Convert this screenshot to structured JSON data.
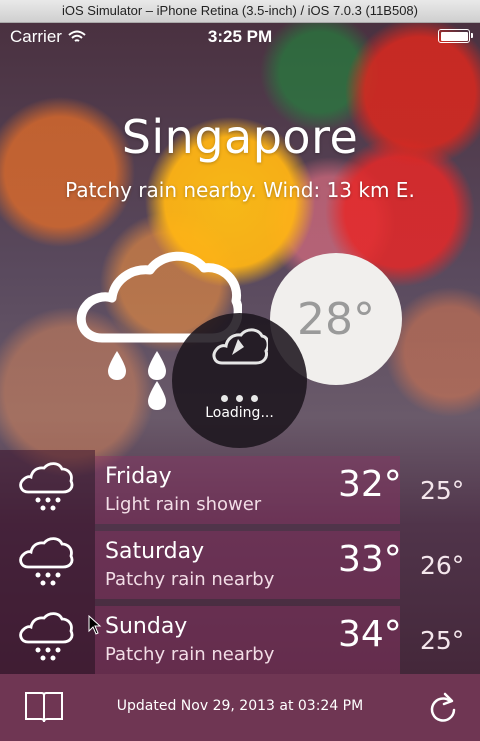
{
  "window": {
    "title": "iOS Simulator – iPhone Retina (3.5-inch) / iOS 7.0.3 (11B508)"
  },
  "status_bar": {
    "carrier": "Carrier",
    "time": "3:25 PM",
    "wifi_icon": "wifi-icon",
    "battery_icon": "battery-icon"
  },
  "current": {
    "city": "Singapore",
    "conditions": "Patchy rain nearby. Wind: 13 km E.",
    "temperature": "28°",
    "icon": "cloud-rain-icon"
  },
  "loading": {
    "label": "Loading...",
    "icon": "cloud-lightning-icon"
  },
  "forecast": [
    {
      "day": "Friday",
      "description": "Light rain shower",
      "high": "32°",
      "low": "25°",
      "icon": "cloud-rain-icon"
    },
    {
      "day": "Saturday",
      "description": "Patchy rain nearby",
      "high": "33°",
      "low": "26°",
      "icon": "cloud-rain-icon"
    },
    {
      "day": "Sunday",
      "description": "Patchy rain nearby",
      "high": "34°",
      "low": "25°",
      "icon": "cloud-rain-icon"
    }
  ],
  "toolbar": {
    "updated": "Updated Nov 29, 2013 at 03:24 PM",
    "left_icon": "book-icon",
    "right_icon": "refresh-icon"
  },
  "colors": {
    "toolbar": "#6f3653",
    "temp_circle": "#f1efed",
    "temp_text": "#9a9a9a",
    "loading_circle": "#1c161e"
  }
}
